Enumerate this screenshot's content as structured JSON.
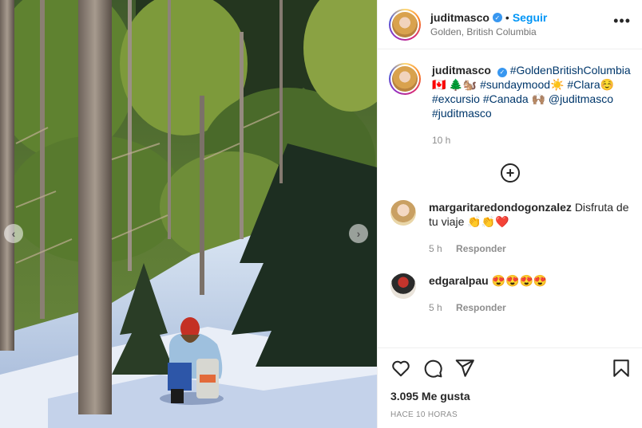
{
  "post": {
    "username": "juditmasco",
    "verified_icon": "verified-badge-icon",
    "separator": "•",
    "follow_label": "Seguir",
    "location": "Golden, British Columbia",
    "more_icon": "more-options-icon",
    "more_label": "•••"
  },
  "caption": {
    "username": "juditmasco",
    "line1_tag": "#GoldenBritishColumbia",
    "line2_flag": "🇨🇦",
    "line2_tree": "🌲",
    "line2_squirrel": "🐿️",
    "line2_tag1": "#sundaymood",
    "line2_sun": "☀️",
    "line2_tag2": "#Clara",
    "line2_smile": "☺️",
    "line3_tag1": "#excursio",
    "line3_tag2": "#Canada",
    "line3_hands": "🙌🏽",
    "line3_mention": "@juditmasco",
    "line4_tag": "#juditmasco",
    "time": "10 h"
  },
  "load_more_icon": "plus-circle-icon",
  "load_more_label": "+",
  "comments": [
    {
      "username": "margaritaredondogonzalez",
      "text": "Disfruta de tu viaje 👏👏❤️",
      "time": "5 h",
      "reply_label": "Responder"
    },
    {
      "username": "edgaralpau",
      "text": "😍😍😍😍",
      "time": "5 h",
      "reply_label": "Responder"
    }
  ],
  "actions": {
    "like_icon": "heart-icon",
    "comment_icon": "comment-icon",
    "share_icon": "share-icon",
    "save_icon": "bookmark-icon",
    "likes": "3.095 Me gusta",
    "posted": "HACE 10 HORAS"
  },
  "carousel": {
    "prev_icon": "chevron-left-icon",
    "prev_label": "‹",
    "next_icon": "chevron-right-icon",
    "next_label": "›"
  },
  "colors": {
    "accent": "#0095f6",
    "verified": "#3897f0",
    "heart": "#ed4956"
  }
}
